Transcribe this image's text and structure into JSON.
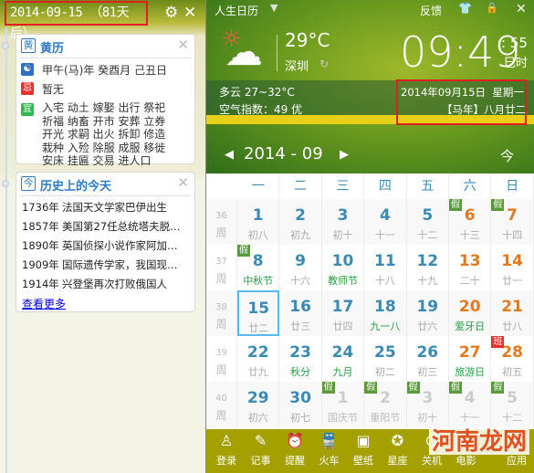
{
  "left": {
    "title": "2014-09-15 （81天后）",
    "huangli": {
      "title": "黄历",
      "icon": "黄",
      "ganzhi": "甲午(马)年 癸酉月 己丑日",
      "ji_label": "忌",
      "ji": "暂无",
      "yi_label": "宜",
      "yi": [
        "入宅 动土 嫁娶 出行 祭祀",
        "祈福 纳畜 开市 安葬 立券",
        "开光 求嗣 出火 拆卸 修造",
        "栽种 入殓 除服 成服 移徙",
        "安床 挂匾 交易 进人口"
      ]
    },
    "history": {
      "title": "历史上的今天",
      "icon": "今",
      "items": [
        {
          "year": "1736年",
          "text": "法国天文学家巴伊出生"
        },
        {
          "year": "1857年",
          "text": "美国第27任总统塔夫脱…"
        },
        {
          "year": "1890年",
          "text": "英国侦探小说作家阿加…"
        },
        {
          "year": "1909年",
          "text": "国际遗传学家，我国现…"
        },
        {
          "year": "1914年",
          "text": "兴登堡再次打败俄国人"
        }
      ],
      "more": "查看更多"
    }
  },
  "header": {
    "app_title": "人生日历",
    "feedback": "反馈",
    "weather": {
      "temp": "29°C",
      "city": "深圳",
      "desc": "多云 27~32°C",
      "aqi": "空气指数：49 优"
    },
    "time": "09:49",
    "seconds": ": 55",
    "shichen": "巳时",
    "date": "2014年09月15日  星期一",
    "lunar": "【马年】八月廿二",
    "month_nav": "2014 - 09",
    "today_btn": "今"
  },
  "calendar": {
    "weekdays": [
      "一",
      "二",
      "三",
      "四",
      "五",
      "六",
      "日"
    ],
    "week_suffix": "周",
    "weeks": [
      {
        "no": "36",
        "days": [
          [
            "1",
            "初八"
          ],
          [
            "2",
            "初九"
          ],
          [
            "3",
            "初十"
          ],
          [
            "4",
            "十一"
          ],
          [
            "5",
            "十二"
          ],
          [
            "6",
            "十三",
            "假"
          ],
          [
            "7",
            "十四",
            "假"
          ]
        ]
      },
      {
        "no": "37",
        "days": [
          [
            "8",
            "中秋节",
            "假",
            "fest"
          ],
          [
            "9",
            "十六"
          ],
          [
            "10",
            "教师节",
            "",
            "fest"
          ],
          [
            "11",
            "十八"
          ],
          [
            "12",
            "十九"
          ],
          [
            "13",
            "二十"
          ],
          [
            "14",
            "廿一"
          ]
        ]
      },
      {
        "no": "38",
        "days": [
          [
            "15",
            "廿二",
            "",
            "",
            "today"
          ],
          [
            "16",
            "廿三"
          ],
          [
            "17",
            "廿四"
          ],
          [
            "18",
            "九一八",
            "",
            "fest"
          ],
          [
            "19",
            "廿六"
          ],
          [
            "20",
            "爱牙日",
            "",
            "fest"
          ],
          [
            "21",
            "廿八"
          ]
        ]
      },
      {
        "no": "39",
        "days": [
          [
            "22",
            "廿九"
          ],
          [
            "23",
            "秋分",
            "",
            "fest"
          ],
          [
            "24",
            "九月",
            "",
            "fest"
          ],
          [
            "25",
            "初二"
          ],
          [
            "26",
            "初三"
          ],
          [
            "27",
            "旅游日",
            "",
            "fest"
          ],
          [
            "28",
            "初五",
            "班"
          ]
        ]
      },
      {
        "no": "40",
        "days": [
          [
            "29",
            "初六"
          ],
          [
            "30",
            "初七"
          ],
          [
            "1",
            "国庆节",
            "假",
            "",
            "other"
          ],
          [
            "2",
            "重阳节",
            "假",
            "",
            "other"
          ],
          [
            "3",
            "初十",
            "假",
            "",
            "other"
          ],
          [
            "4",
            "十一",
            "假",
            "",
            "other"
          ],
          [
            "5",
            "十二",
            "假",
            "",
            "other"
          ]
        ]
      }
    ]
  },
  "toolbar": [
    {
      "label": "登录",
      "icon": "user-icon"
    },
    {
      "label": "记事",
      "icon": "note-icon"
    },
    {
      "label": "提醒",
      "icon": "alarm-icon"
    },
    {
      "label": "火车",
      "icon": "train-icon"
    },
    {
      "label": "壁纸",
      "icon": "image-icon"
    },
    {
      "label": "星座",
      "icon": "star-icon"
    },
    {
      "label": "关机",
      "icon": "power-icon"
    },
    {
      "label": "电影",
      "icon": "film-icon"
    },
    {
      "label": "应用",
      "icon": "apps-icon"
    }
  ],
  "watermark": "河南龙网",
  "colors": {
    "weekday": "#3a8ab4",
    "weekend": "#e07a20",
    "festival": "#22a040",
    "holiday_tag": "#5a9a3a",
    "work_tag": "#e83030",
    "toolbar": "#a3a000"
  }
}
